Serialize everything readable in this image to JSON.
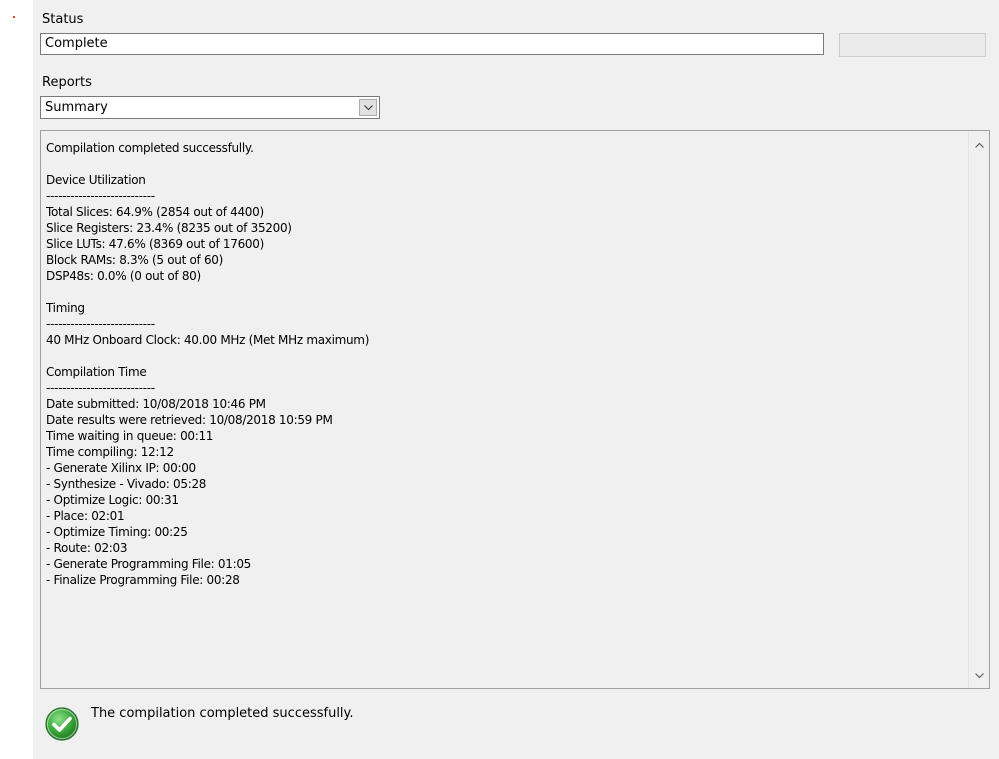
{
  "status": {
    "label": "Status",
    "value": "Complete"
  },
  "reports": {
    "label": "Reports",
    "selected": "Summary"
  },
  "report_text": "Compilation completed successfully.\n\nDevice Utilization\n---------------------------\nTotal Slices: 64.9% (2854 out of 4400)\nSlice Registers: 23.4% (8235 out of 35200)\nSlice LUTs: 47.6% (8369 out of 17600)\nBlock RAMs: 8.3% (5 out of 60)\nDSP48s: 0.0% (0 out of 80)\n\nTiming\n---------------------------\n40 MHz Onboard Clock: 40.00 MHz (Met MHz maximum)\n\nCompilation Time\n---------------------------\nDate submitted: 10/08/2018 10:46 PM\nDate results were retrieved: 10/08/2018 10:59 PM\nTime waiting in queue: 00:11\nTime compiling: 12:12\n- Generate Xilinx IP: 00:00\n- Synthesize - Vivado: 05:28\n- Optimize Logic: 00:31\n- Place: 02:01\n- Optimize Timing: 00:25\n- Route: 02:03\n- Generate Programming File: 01:05\n- Finalize Programming File: 00:28",
  "footer": {
    "message": "The compilation completed successfully.",
    "icon": "check-circle-icon"
  },
  "colors": {
    "panel_bg": "#f0f0f0",
    "success_green": "#3aa83a"
  }
}
